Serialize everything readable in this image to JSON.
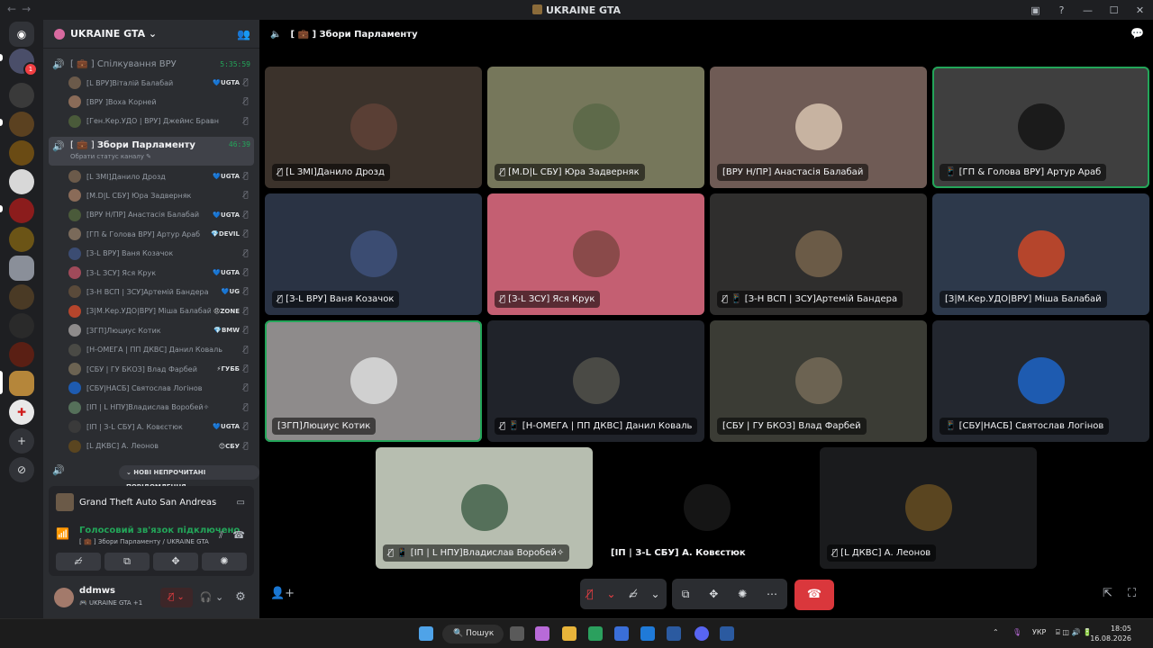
{
  "window": {
    "title": "UKRAINE GTA",
    "nav_back": "←",
    "nav_fwd": "→"
  },
  "guild": {
    "name": "UKRAINE GTA ⌄"
  },
  "channels": [
    {
      "prefix": "[ 💼 ]",
      "name": "Спілкування ВРУ",
      "timer": "5:35:59"
    },
    {
      "prefix": "[ 💼 ]",
      "name": "Збори Парламенту",
      "timer": "46:39",
      "sub": "Обрати статус каналу ✎"
    }
  ],
  "channel1_members": [
    {
      "name": "[L ВРУ]Віталій Балабай",
      "tag": "💙UGTA"
    },
    {
      "name": "[ВРУ ]Воха Корней",
      "tag": ""
    },
    {
      "name": "[Ген.Кер.УДО | ВРУ] Джеймс Бравн",
      "tag": ""
    }
  ],
  "channel2_members": [
    {
      "name": "[L ЗМІ]Данило Дрозд",
      "tag": "💙UGTA"
    },
    {
      "name": "[M.D|L СБУ] Юра Задверняк",
      "tag": ""
    },
    {
      "name": "[ВРУ Н/ПР] Анастасія Балабай",
      "tag": "💙UGTA"
    },
    {
      "name": "[ГП & Голова ВРУ] Артур Араб",
      "tag": "💎DEVIL"
    },
    {
      "name": "[З-L ВРУ] Ваня Козачок",
      "tag": ""
    },
    {
      "name": "[З-L ЗСУ] Яся Крук",
      "tag": "💙UGTA"
    },
    {
      "name": "[З-Н ВСП | ЗСУ]Артемій Бандера",
      "tag": "💙UG"
    },
    {
      "name": "[З|М.Кер.УДО|ВРУ] Міша Балабай",
      "tag": "😠ZONE"
    },
    {
      "name": "[ЗГП]Люциус Котик",
      "tag": "💎BMW"
    },
    {
      "name": "[Н-ОМЕГА | ПП ДКВС] Данил Коваль",
      "tag": ""
    },
    {
      "name": "[СБУ | ГУ БКОЗ] Влад Фарбей",
      "tag": "⚡ГУББ"
    },
    {
      "name": "[СБУ|НАСБ] Святослав Логінов",
      "tag": ""
    },
    {
      "name": "[ІП | L НПУ]Владислав Воробей✧",
      "tag": ""
    },
    {
      "name": "[ІП | З-L СБУ] А. Ковєстюк",
      "tag": "💙UGTA"
    },
    {
      "name": "[L ДКВС] А. Леонов",
      "tag": "😊СБУ"
    }
  ],
  "unread_banner": "⌄ НОВІ НЕПРОЧИТАНІ ПОВІДОМЛЕННЯ",
  "activity": {
    "name": "Grand Theft Auto San Andreas"
  },
  "voice": {
    "status": "Голосовий зв'язок підключено",
    "detail": "[ 💼 ] Збори Парламенту / UKRAINE GTA"
  },
  "user": {
    "name": "ddmws",
    "status": "🎮 UKRAINE GTA +1"
  },
  "stage": {
    "channel": "[ 💼 ] Збори Парламенту"
  },
  "tiles": [
    {
      "label": "🎙̸ [L ЗМІ]Данило Дрозд",
      "bg": "#3b322b",
      "av": "#5a3f35"
    },
    {
      "label": "🎙̸ [M.D|L СБУ] Юра Задверняк",
      "bg": "#76775b",
      "av": "#5e6a4a"
    },
    {
      "label": "[ВРУ Н/ПР] Анастасія Балабай",
      "bg": "#6f5b55",
      "av": "#c7b3a1"
    },
    {
      "label": "📱 [ГП & Голова ВРУ] Артур Араб",
      "bg": "#3f3f3f",
      "av": "#1b1b1b"
    },
    {
      "label": "🎙̸ [З-L ВРУ] Ваня Козачок",
      "bg": "#2a3344",
      "av": "#3b4c72"
    },
    {
      "label": "🎙̸ [З-L ЗСУ] Яся Крук",
      "bg": "#c45f72",
      "av": "#8a4a4a"
    },
    {
      "label": "🎙̸ 📱 [З-Н ВСП | ЗСУ]Артемій Бандера",
      "bg": "#2f2e2d",
      "av": "#6b5b47"
    },
    {
      "label": "[З|М.Кер.УДО|ВРУ] Міша Балабай",
      "bg": "#2d394b",
      "av": "#b5452c"
    },
    {
      "label": "[ЗГП]Люциус Котик",
      "bg": "#8e8b8b",
      "av": "#d0d0d0"
    },
    {
      "label": "🎙̸ 📱 [Н-ОМЕГА | ПП ДКВС] Данил Коваль",
      "bg": "#20232a",
      "av": "#4a4a45"
    },
    {
      "label": "[СБУ | ГУ БКОЗ] Влад Фарбей",
      "bg": "#3b3c35",
      "av": "#6c6352"
    },
    {
      "label": "📱 [СБУ|НАСБ] Святослав Логінов",
      "bg": "#23272f",
      "av": "#1e5bb0"
    },
    {
      "label": "🎙̸ 📱 [ІП | L НПУ]Владислав Воробей✧",
      "bg": "#b7beb0",
      "av": "#55705a"
    },
    {
      "label": "[ІП | З-L СБУ] А. Ковєстюк",
      "bg": "#000000",
      "av": "#151515"
    },
    {
      "label": "🎙̸ [L ДКВС] А. Леонов",
      "bg": "#1a1b1d",
      "av": "#5a4520"
    }
  ],
  "taskbar": {
    "search": "🔍 Пошук",
    "lang": "УКР",
    "time": "18:05",
    "date": "16.08.2026"
  }
}
